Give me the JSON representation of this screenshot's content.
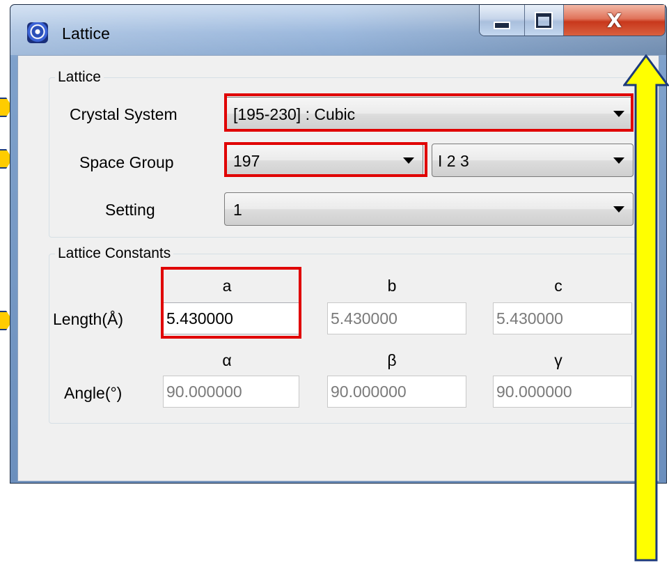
{
  "window": {
    "title": "Lattice",
    "caption_buttons": {
      "minimize": "",
      "maximize": "",
      "close": "X"
    }
  },
  "lattice_group": {
    "legend": "Lattice",
    "crystal_system": {
      "label": "Crystal System",
      "value": "[195-230] : Cubic"
    },
    "space_group": {
      "label": "Space Group",
      "number": "197",
      "symbol": "I 2 3"
    },
    "setting": {
      "label": "Setting",
      "value": "1"
    }
  },
  "constants_group": {
    "legend": "Lattice Constants",
    "length_label": "Length(Å)",
    "angle_label": "Angle(°)",
    "length_headers": [
      "a",
      "b",
      "c"
    ],
    "angle_headers": [
      "α",
      "β",
      "γ"
    ],
    "lengths": [
      "5.430000",
      "5.430000",
      "5.430000"
    ],
    "angles": [
      "90.000000",
      "90.000000",
      "90.000000"
    ]
  },
  "annotation": {
    "highlight_color": "#e00000",
    "arrow_color": "#ffff00"
  }
}
